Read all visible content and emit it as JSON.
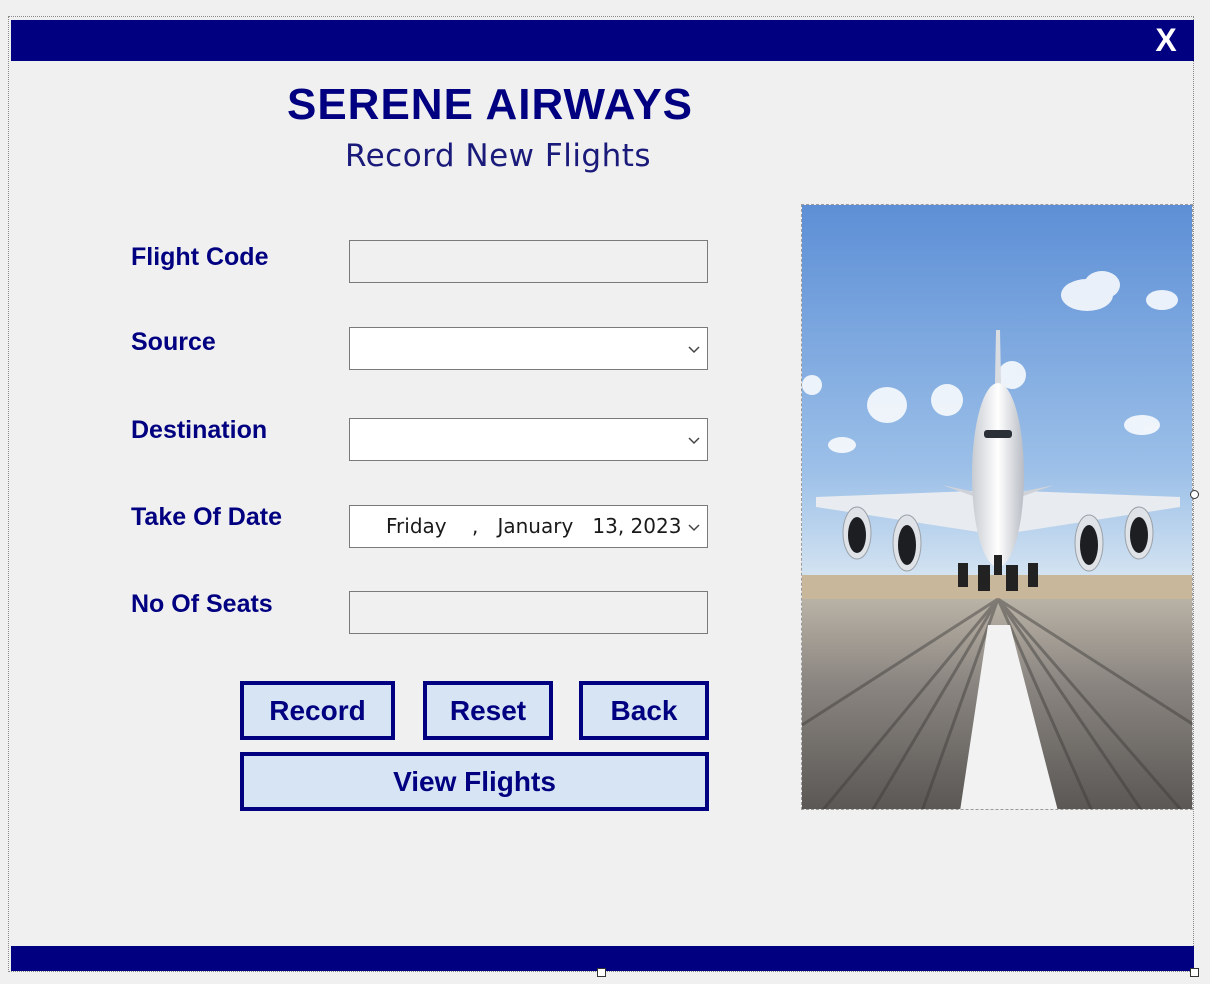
{
  "window": {
    "close_label": "X"
  },
  "header": {
    "title": "SERENE AIRWAYS",
    "subtitle": "Record New Flights"
  },
  "form": {
    "flight_code_label": "Flight Code",
    "flight_code_value": "",
    "source_label": "Source",
    "source_value": "",
    "destination_label": "Destination",
    "destination_value": "",
    "take_off_date_label": "Take Of Date",
    "take_off_date_value": "Friday    ,   January   13, 2023",
    "seats_label": "No Of Seats",
    "seats_value": ""
  },
  "buttons": {
    "record": "Record",
    "reset": "Reset",
    "back": "Back",
    "view_flights": "View Flights"
  },
  "image": {
    "description_icon": "airplane-runway-photo"
  },
  "colors": {
    "brand_navy": "#000080",
    "button_fill": "#d6e4f3",
    "form_background": "#f0f0f0"
  }
}
